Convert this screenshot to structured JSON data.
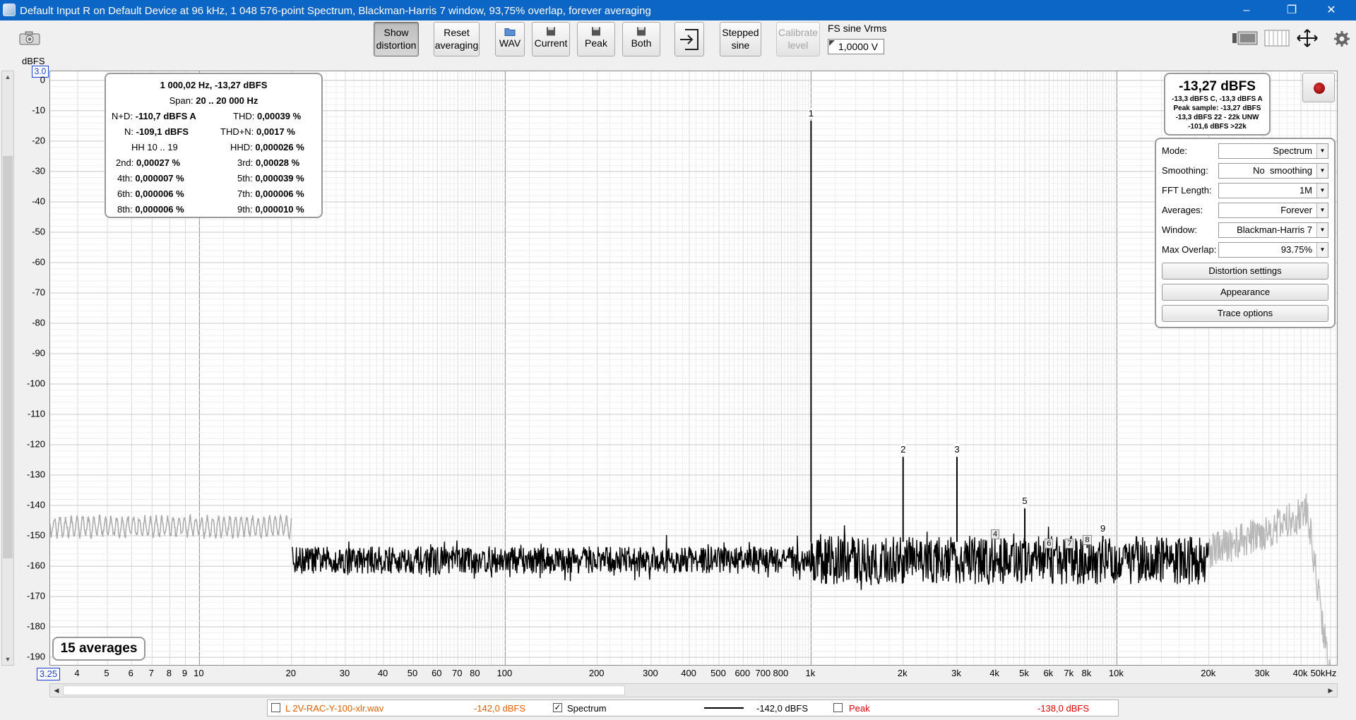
{
  "window": {
    "title": "Default Input R on Default Device at 96 kHz, 1 048 576-point Spectrum, Blackman-Harris 7 window, 93,75% overlap, forever averaging",
    "minimize": "–",
    "restore": "❐",
    "close": "✕"
  },
  "toolbar": {
    "show_distortion_l1": "Show",
    "show_distortion_l2": "distortion",
    "reset_averaging_l1": "Reset",
    "reset_averaging_l2": "averaging",
    "wav": "WAV",
    "current": "Current",
    "peak": "Peak",
    "both": "Both",
    "stepped_sine_l1": "Stepped",
    "stepped_sine_l2": "sine",
    "calibrate_level_l1": "Calibrate",
    "calibrate_level_l2": "level",
    "fs_sine_label": "FS sine Vrms",
    "fs_sine_value": "1,0000 V"
  },
  "plot": {
    "y_unit": "dBFS",
    "y_top_box": "3.0",
    "y_ticks": [
      "0",
      "-10",
      "-20",
      "-30",
      "-40",
      "-50",
      "-60",
      "-70",
      "-80",
      "-90",
      "-100",
      "-110",
      "-120",
      "-130",
      "-140",
      "-150",
      "-160",
      "-170",
      "-180",
      "-190"
    ],
    "x_left_box": "3.25",
    "x_ticks": [
      {
        "f": 4,
        "l": "4"
      },
      {
        "f": 5,
        "l": "5"
      },
      {
        "f": 6,
        "l": "6"
      },
      {
        "f": 7,
        "l": "7"
      },
      {
        "f": 8,
        "l": "8"
      },
      {
        "f": 9,
        "l": "9"
      },
      {
        "f": 10,
        "l": "10"
      },
      {
        "f": 20,
        "l": "20"
      },
      {
        "f": 30,
        "l": "30"
      },
      {
        "f": 40,
        "l": "40"
      },
      {
        "f": 50,
        "l": "50"
      },
      {
        "f": 60,
        "l": "60"
      },
      {
        "f": 70,
        "l": "70"
      },
      {
        "f": 80,
        "l": "80"
      },
      {
        "f": 100,
        "l": "100"
      },
      {
        "f": 200,
        "l": "200"
      },
      {
        "f": 300,
        "l": "300"
      },
      {
        "f": 400,
        "l": "400"
      },
      {
        "f": 500,
        "l": "500"
      },
      {
        "f": 600,
        "l": "600"
      },
      {
        "f": 700,
        "l": "700"
      },
      {
        "f": 800,
        "l": "800"
      },
      {
        "f": 1000,
        "l": "1k"
      },
      {
        "f": 2000,
        "l": "2k"
      },
      {
        "f": 3000,
        "l": "3k"
      },
      {
        "f": 4000,
        "l": "4k"
      },
      {
        "f": 5000,
        "l": "5k"
      },
      {
        "f": 6000,
        "l": "6k"
      },
      {
        "f": 7000,
        "l": "7k"
      },
      {
        "f": 8000,
        "l": "8k"
      },
      {
        "f": 10000,
        "l": "10k"
      },
      {
        "f": 20000,
        "l": "20k"
      },
      {
        "f": 30000,
        "l": "30k"
      },
      {
        "f": 40000,
        "l": "40k"
      },
      {
        "f": 50000,
        "l": "50kHz"
      }
    ],
    "harmonics": [
      {
        "n": "1",
        "f": 1000,
        "db": -13.3
      },
      {
        "n": "2",
        "f": 2000,
        "db": -124
      },
      {
        "n": "3",
        "f": 3000,
        "db": -124
      },
      {
        "n": "4",
        "f": 4000,
        "db": -152
      },
      {
        "n": "5",
        "f": 5000,
        "db": -141
      },
      {
        "n": "6",
        "f": 6000,
        "db": -155
      },
      {
        "n": "7",
        "f": 7000,
        "db": -155
      },
      {
        "n": "8",
        "f": 8000,
        "db": -154
      },
      {
        "n": "9",
        "f": 9000,
        "db": -150
      }
    ],
    "averages": "15 averages"
  },
  "distortion": {
    "header": "1 000,02 Hz, -13,27 dBFS",
    "span_label": "Span:",
    "span_value": "20 .. 20 000 Hz",
    "nd_label": "N+D:",
    "nd_value": "-110,7 dBFS A",
    "thd_label": "THD:",
    "thd_value": "0,00039 %",
    "n_label": "N:",
    "n_value": "-109,1 dBFS",
    "thdn_label": "THD+N:",
    "thdn_value": "0,0017 %",
    "hh_label": "HH 10 .. 19",
    "hhd_label": "HHD:",
    "hhd_value": "0,000026 %",
    "h2_label": "2nd:",
    "h2_value": "0,00027 %",
    "h3_label": "3rd:",
    "h3_value": "0,00028 %",
    "h4_label": "4th:",
    "h4_value": "0,000007 %",
    "h5_label": "5th:",
    "h5_value": "0,000039 %",
    "h6_label": "6th:",
    "h6_value": "0,000006 %",
    "h7_label": "7th:",
    "h7_value": "0,000006 %",
    "h8_label": "8th:",
    "h8_value": "0,000006 %",
    "h9_label": "9th:",
    "h9_value": "0,000010 %"
  },
  "level": {
    "main": "-13,27 dBFS",
    "l1": "-13,3 dBFS C, -13,3 dBFS A",
    "l2": "Peak sample: -13,27 dBFS",
    "l3": "-13,3 dBFS 22 - 22k UNW",
    "l4": "-101,6 dBFS >22k"
  },
  "settings": {
    "mode_label": "Mode:",
    "mode_value": "Spectrum",
    "smoothing_label": "Smoothing:",
    "smoothing_value": "No  smoothing",
    "fft_label": "FFT Length:",
    "fft_value": "1M",
    "averages_label": "Averages:",
    "averages_value": "Forever",
    "window_label": "Window:",
    "window_value": "Blackman-Harris 7",
    "overlap_label": "Max Overlap:",
    "overlap_value": "93.75%",
    "distortion_settings": "Distortion settings",
    "appearance": "Appearance",
    "trace_options": "Trace options"
  },
  "legend": {
    "wav_name": "L 2V-RAC-Y-100-xlr.wav",
    "wav_value": "-142,0 dBFS",
    "spectrum_name": "Spectrum",
    "spectrum_value": "-142,0 dBFS",
    "peak_name": "Peak",
    "peak_value": "-138,0 dBFS",
    "wav_color": "#e06000",
    "peak_color": "#e00000"
  }
}
